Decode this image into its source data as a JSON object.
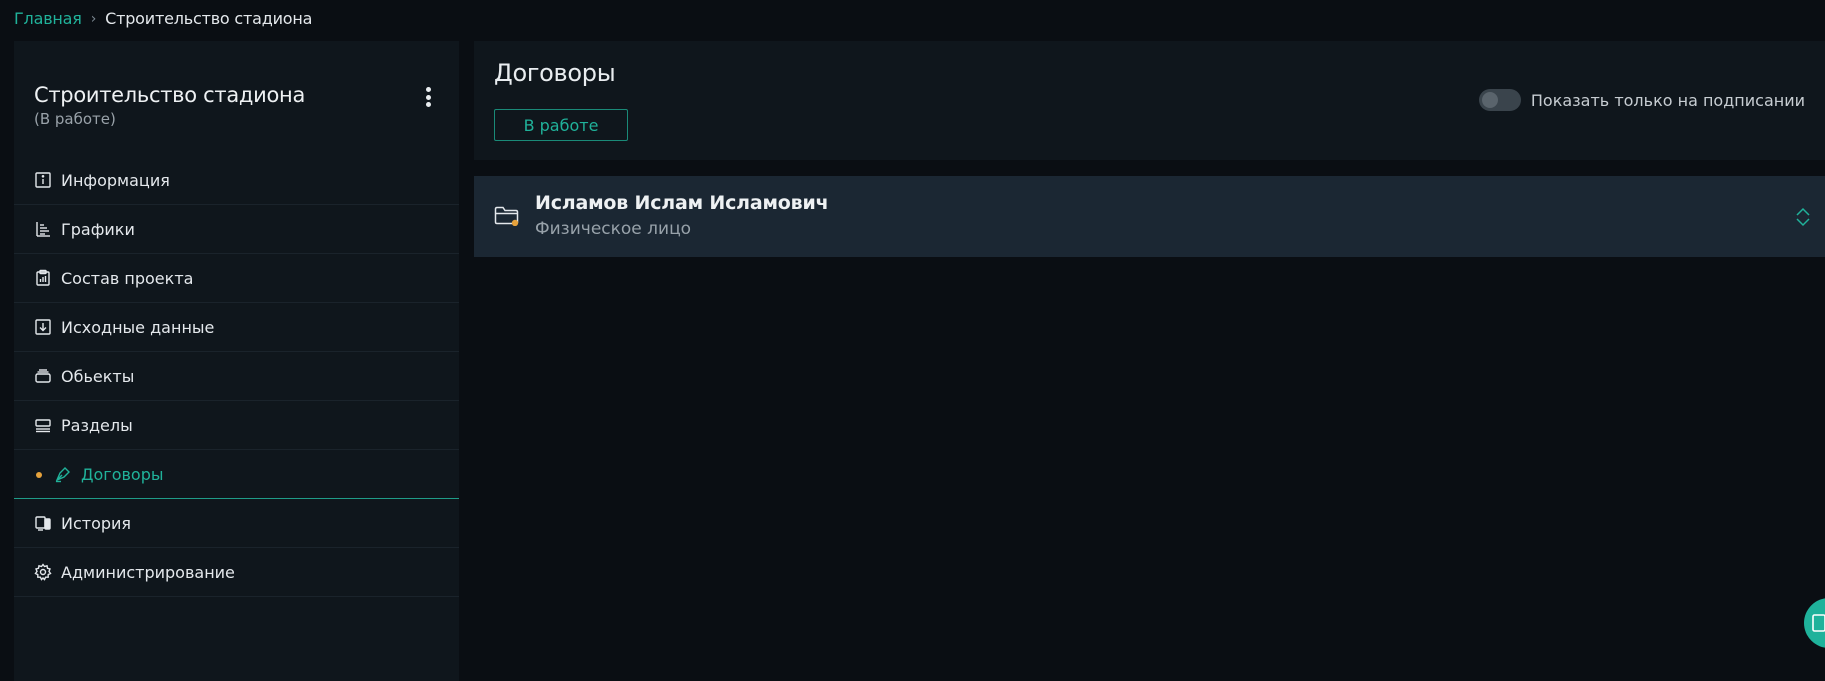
{
  "breadcrumb": {
    "home": "Главная",
    "separator": "›",
    "current": "Строительство стадиона"
  },
  "project": {
    "title": "Строительство стадиона",
    "status": "(В работе)",
    "menu_icon": "kebab-menu-icon"
  },
  "sidebar": {
    "items": [
      {
        "label": "Информация",
        "icon": "info-icon"
      },
      {
        "label": "Графики",
        "icon": "chart-tree-icon"
      },
      {
        "label": "Состав проекта",
        "icon": "clipboard-chart-icon"
      },
      {
        "label": "Исходные данные",
        "icon": "download-box-icon"
      },
      {
        "label": "Обьекты",
        "icon": "layers-icon"
      },
      {
        "label": "Разделы",
        "icon": "sections-icon"
      },
      {
        "label": "Договоры",
        "icon": "pen-nib-icon",
        "active": true
      },
      {
        "label": "История",
        "icon": "history-devices-icon"
      },
      {
        "label": "Администрирование",
        "icon": "gear-icon"
      }
    ]
  },
  "main": {
    "title": "Договоры",
    "status_button": "В работе",
    "toggle_label": "Показать только на подписании",
    "toggle_on": false
  },
  "contracts": [
    {
      "name": "Исламов Ислам Исламович",
      "type": "Физическое лицо",
      "icon": "folder-icon",
      "badge_color": "#e6a23c"
    }
  ],
  "colors": {
    "accent": "#20b29a",
    "badge": "#e6a23c",
    "background": "#0a0e13",
    "panel": "#0f161c",
    "row": "#1b2733"
  }
}
